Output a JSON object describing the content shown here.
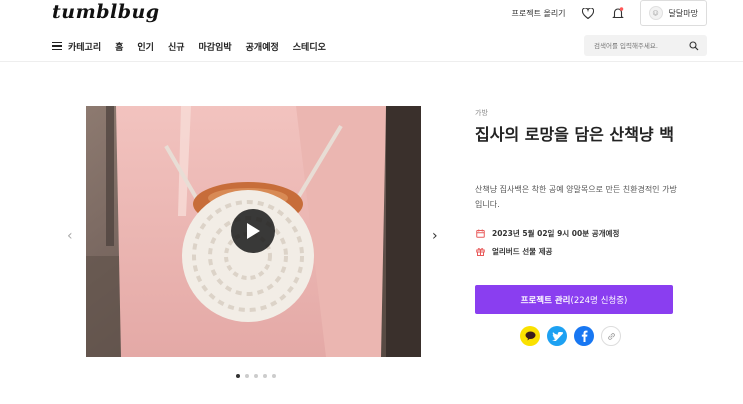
{
  "header": {
    "logo": "tumblbug",
    "upload_label": "프로젝트 올리기",
    "user_name": "달달마망",
    "avatar_glyph": "☺"
  },
  "nav": {
    "category_label": "카테고리",
    "items": [
      "홈",
      "인기",
      "신규",
      "마감임박",
      "공개예정",
      "스테디오"
    ]
  },
  "search": {
    "placeholder": "검색어를 입력해주세요."
  },
  "carousel": {
    "prev_glyph": "‹",
    "next_glyph": "›",
    "total_slides": 5,
    "active_slide": 1
  },
  "project": {
    "category": "가방",
    "title": "집사의 로망을 담은 산책냥 백",
    "description": "산책냥 집사백은 착한 공예 양말목으로 만든 친환경적인 가방입니다.",
    "release_date": "2023년 5월 02일 9시 00분 공개예정",
    "gift": "얼리버드 선물 제공",
    "cta_main": "프로젝트 관리",
    "cta_count": "(224명 신청중)"
  },
  "colors": {
    "accent": "#8a3ef0",
    "calendar_icon": "#e85a5a",
    "kakao": "#fae100",
    "twitter": "#1da1f2",
    "facebook": "#1877f2"
  },
  "icons": [
    "heart-icon",
    "bell-icon",
    "search-icon",
    "play-icon",
    "calendar-icon",
    "gift-icon",
    "kakao-icon",
    "twitter-icon",
    "facebook-icon",
    "link-icon"
  ]
}
